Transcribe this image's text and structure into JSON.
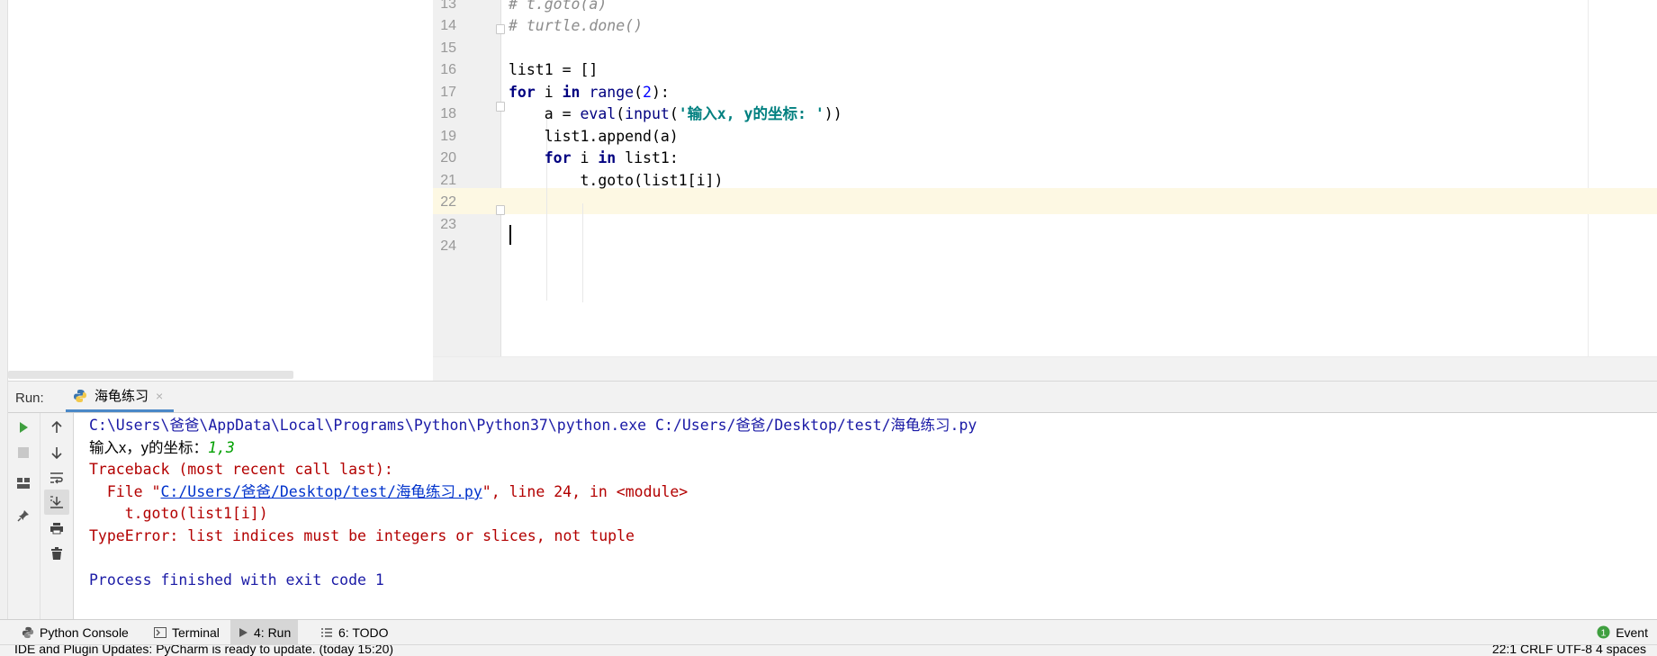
{
  "editor": {
    "lines": [
      {
        "num": "13",
        "text": "# t.goto(a)"
      },
      {
        "num": "14",
        "text": "# turtle.done()"
      },
      {
        "num": "15",
        "text": ""
      },
      {
        "num": "16",
        "text": "list1 = []"
      },
      {
        "num": "17",
        "text": "for i in range(2):"
      },
      {
        "num": "18",
        "text": "    a = eval(input('输入x, y的坐标: '))"
      },
      {
        "num": "19",
        "text": "    list1.append(a)"
      },
      {
        "num": "20",
        "text": "    for i in list1:"
      },
      {
        "num": "21",
        "text": "        t.goto(list1[i])"
      },
      {
        "num": "22",
        "text": ""
      },
      {
        "num": "23",
        "text": ""
      },
      {
        "num": "24",
        "text": ""
      }
    ],
    "current_line": "22"
  },
  "run": {
    "label": "Run:",
    "tab_title": "海龟练习",
    "close_glyph": "×"
  },
  "console": {
    "cmd": "C:\\Users\\爸爸\\AppData\\Local\\Programs\\Python\\Python37\\python.exe C:/Users/爸爸/Desktop/test/海龟练习.py",
    "prompt": "输入x，y的坐标：",
    "user_input": "1,3",
    "traceback_header": "Traceback (most recent call last):",
    "file_prefix": "  File \"",
    "file_link": "C:/Users/爸爸/Desktop/test/海龟练习.py",
    "file_suffix": "\", line 24, in <module>",
    "code_line": "    t.goto(list1[i])",
    "error": "TypeError: list indices must be integers or slices, not tuple",
    "exit": "Process finished with exit code 1"
  },
  "tool_windows": [
    {
      "label": "Python Console",
      "icon": "python-console-icon"
    },
    {
      "label": "Terminal",
      "icon": "terminal-icon"
    },
    {
      "label": "4: Run",
      "icon": "run-icon"
    },
    {
      "label": "6: TODO",
      "icon": "todo-icon"
    }
  ],
  "event_log": {
    "label": "Event",
    "count": "1"
  },
  "status": {
    "message": "IDE and Plugin Updates: PyCharm is ready to update. (today 15:20)",
    "right": "22:1   CRLF   UTF-8   4 spaces"
  },
  "colors": {
    "keyword": "#000080",
    "string": "#008080",
    "error": "#b30000",
    "link": "#0033cc",
    "current_line": "#fdf8e3",
    "accent": "#4a88c7"
  }
}
